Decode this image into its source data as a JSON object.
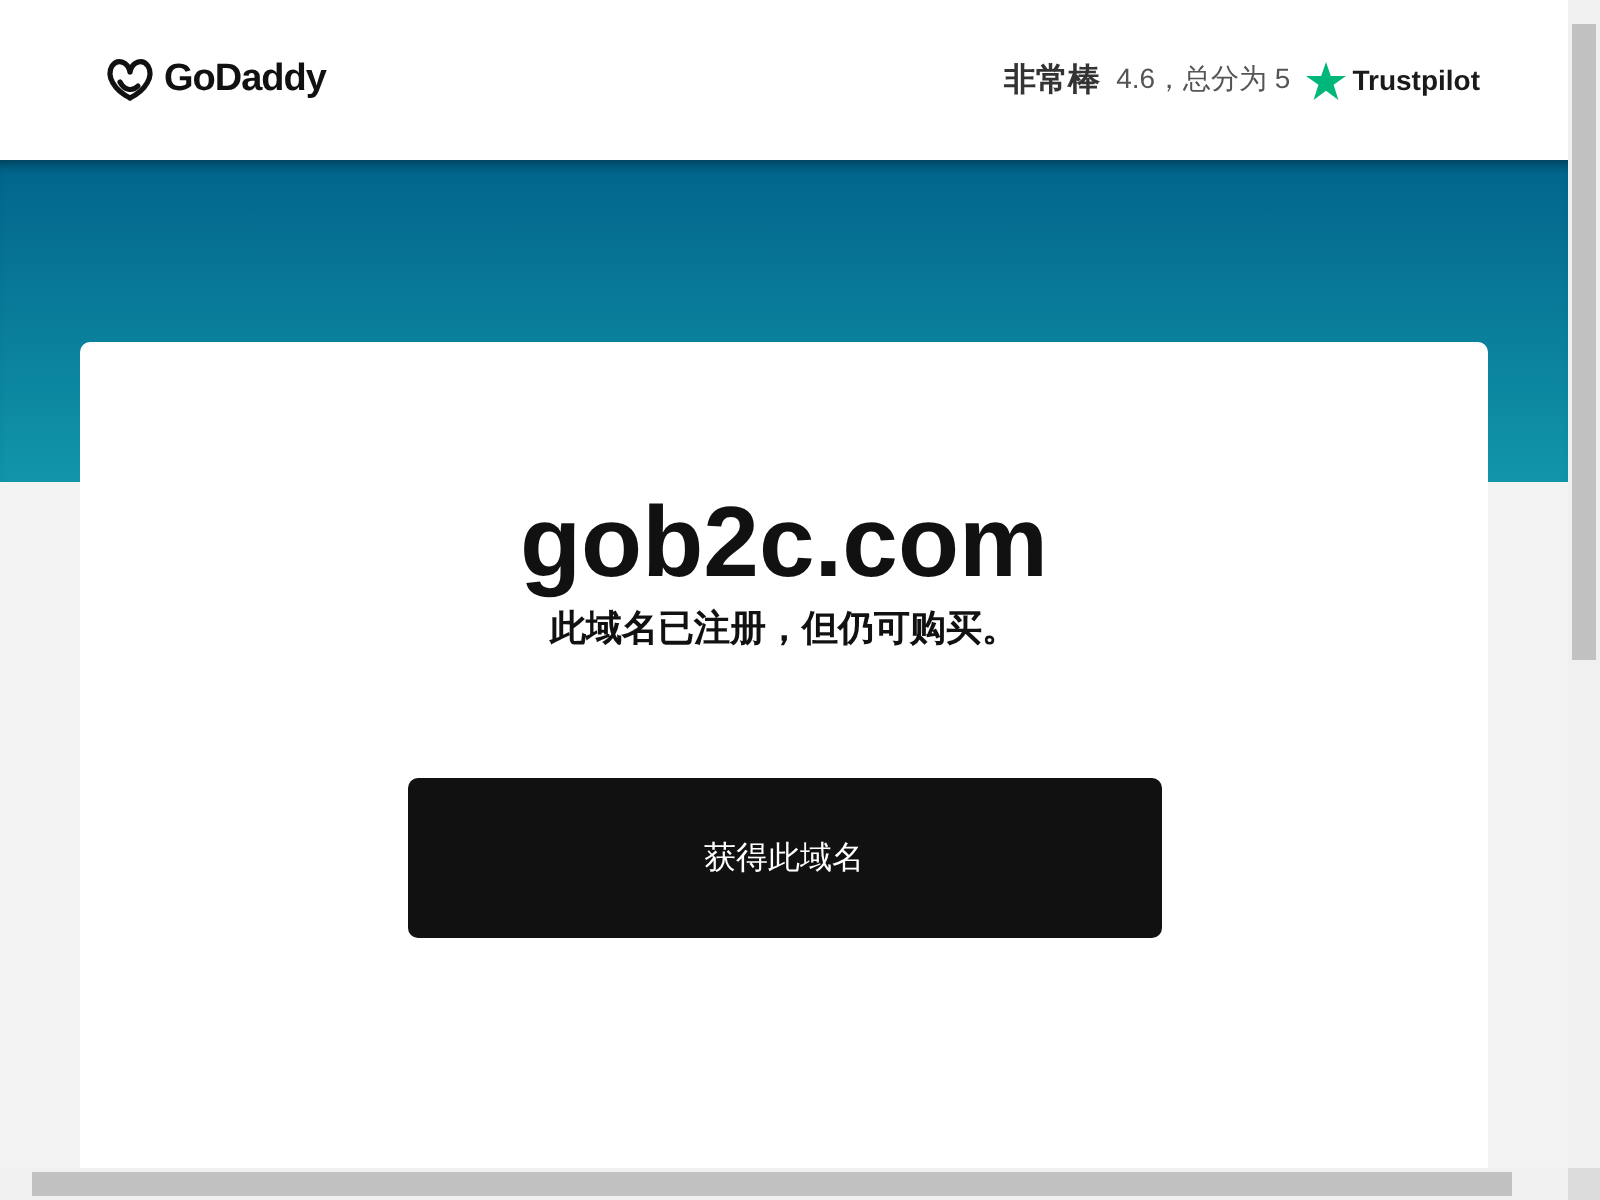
{
  "header": {
    "logo_text": "GoDaddy",
    "rating_label": "非常棒",
    "rating_text": "4.6，总分为 5",
    "trustpilot": "Trustpilot"
  },
  "card": {
    "domain": "gob2c.com",
    "message": "此域名已注册，但仍可购买。",
    "button": "获得此域名"
  }
}
